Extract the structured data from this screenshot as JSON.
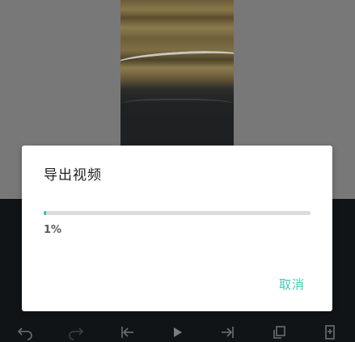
{
  "dialog": {
    "title": "导出视频",
    "progress_fraction": 0.01,
    "progress_text": "1%",
    "cancel_label": "取消"
  },
  "colors": {
    "accent": "#3ccfb0",
    "progress_fill": "#2ec5a3",
    "progress_track": "#dcdcdc",
    "editor_background": "#101416",
    "preview_background": "#787878"
  },
  "toolbar": {
    "icons": [
      "undo-icon",
      "redo-icon",
      "skip-to-start-icon",
      "play-icon",
      "skip-to-end-icon",
      "copy-icon",
      "add-bookmark-icon"
    ]
  }
}
